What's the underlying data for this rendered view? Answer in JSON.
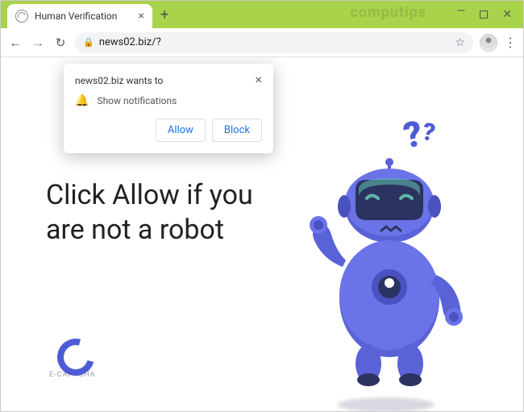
{
  "window": {
    "watermark": "computips"
  },
  "tab": {
    "title": "Human Verification",
    "close": "×"
  },
  "newtab": "+",
  "wincontrols": {
    "min": "—",
    "close": "✕"
  },
  "nav": {
    "back": "←",
    "forward": "→",
    "reload": "↻"
  },
  "omnibox": {
    "lock": "🔒",
    "url": "news02.biz/?",
    "star": "☆"
  },
  "menu": "⋮",
  "notif": {
    "origin": "news02.biz wants to",
    "close": "×",
    "bell": "🔔",
    "text": "Show notifications",
    "allow": "Allow",
    "block": "Block"
  },
  "page": {
    "headline": "Click Allow if you are not a robot",
    "qmark1": "?",
    "qmark2": "?",
    "ecaptcha_label": "E-CAPTCHA"
  }
}
